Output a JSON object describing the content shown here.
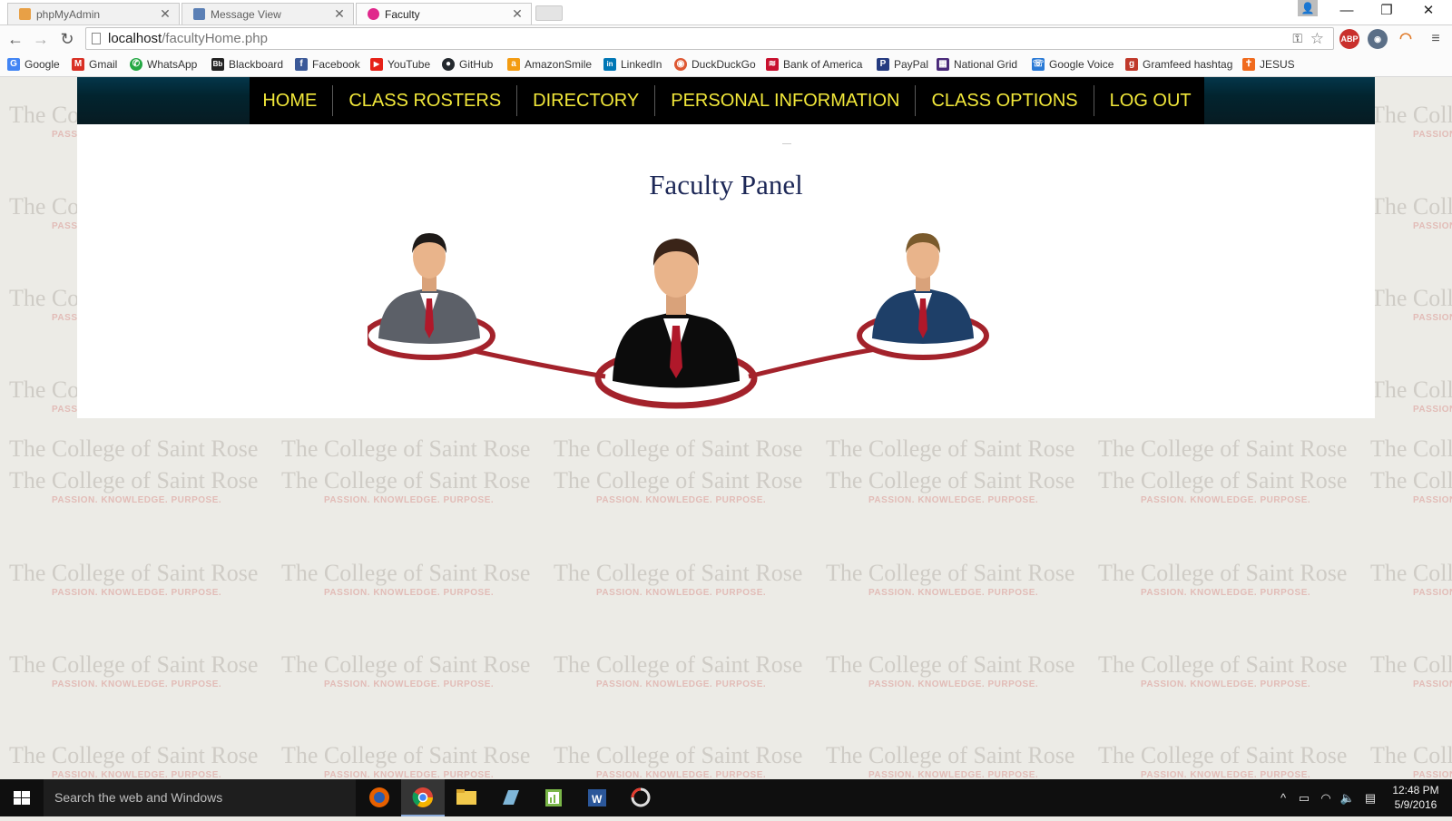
{
  "browser": {
    "tabs": [
      {
        "title": "phpMyAdmin",
        "active": false,
        "favicon_color": "#e8a046"
      },
      {
        "title": "Message View",
        "active": false,
        "favicon_color": "#5a7fb5"
      },
      {
        "title": "Faculty",
        "active": true,
        "favicon_color": "#e0288c"
      }
    ],
    "url_host": "localhost",
    "url_path": "/facultyHome.php",
    "extensions": [
      {
        "name": "ABP",
        "color": "#c9302c"
      },
      {
        "name": "",
        "color": "#5b6f87"
      },
      {
        "name": "",
        "color": "#e07a29"
      }
    ],
    "bookmarks": [
      {
        "label": "Google",
        "icon": "google-icon",
        "color": "#4285f4",
        "glyph": "G"
      },
      {
        "label": "Gmail",
        "icon": "gmail-icon",
        "color": "#d93025",
        "glyph": "M"
      },
      {
        "label": "WhatsApp",
        "icon": "whatsapp-icon",
        "color": "#25a844",
        "glyph": "✆"
      },
      {
        "label": "Blackboard",
        "icon": "blackboard-icon",
        "color": "#222222",
        "glyph": "Bb"
      },
      {
        "label": "Facebook",
        "icon": "facebook-icon",
        "color": "#3b5998",
        "glyph": "f"
      },
      {
        "label": "YouTube",
        "icon": "youtube-icon",
        "color": "#e62117",
        "glyph": "▶"
      },
      {
        "label": "GitHub",
        "icon": "github-icon",
        "color": "#24292e",
        "glyph": "●"
      },
      {
        "label": "AmazonSmile",
        "icon": "amazon-icon",
        "color": "#f39c12",
        "glyph": "a"
      },
      {
        "label": "LinkedIn",
        "icon": "linkedin-icon",
        "color": "#0077b5",
        "glyph": "in"
      },
      {
        "label": "DuckDuckGo",
        "icon": "duckduckgo-icon",
        "color": "#de5833",
        "glyph": "◉"
      },
      {
        "label": "Bank of America",
        "icon": "bankofamerica-icon",
        "color": "#c8102e",
        "glyph": "≋"
      },
      {
        "label": "PayPal",
        "icon": "paypal-icon",
        "color": "#253b80",
        "glyph": "P"
      },
      {
        "label": "National Grid",
        "icon": "nationalgrid-icon",
        "color": "#4a2a7a",
        "glyph": "▦"
      },
      {
        "label": "Google Voice",
        "icon": "googlevoice-icon",
        "color": "#2a7ad6",
        "glyph": "☏"
      },
      {
        "label": "Gramfeed hashtag",
        "icon": "gramfeed-icon",
        "color": "#c0392b",
        "glyph": "g"
      },
      {
        "label": "JESUS",
        "icon": "jesus-icon",
        "color": "#f06a1d",
        "glyph": "✝"
      }
    ]
  },
  "watermark": {
    "title": "The College of Saint Rose",
    "subtitle": "PASSION. KNOWLEDGE. PURPOSE."
  },
  "nav": {
    "items": [
      "HOME",
      "CLASS ROSTERS",
      "DIRECTORY",
      "PERSONAL INFORMATION",
      "CLASS OPTIONS",
      "LOG OUT"
    ]
  },
  "panel": {
    "title": "Faculty Panel"
  },
  "colors": {
    "nav_text": "#f2e83a",
    "panel_title": "#1d2857",
    "ring": "#a3222b"
  },
  "taskbar": {
    "search_placeholder": "Search the web and Windows",
    "time": "12:48 PM",
    "date": "5/9/2016"
  }
}
